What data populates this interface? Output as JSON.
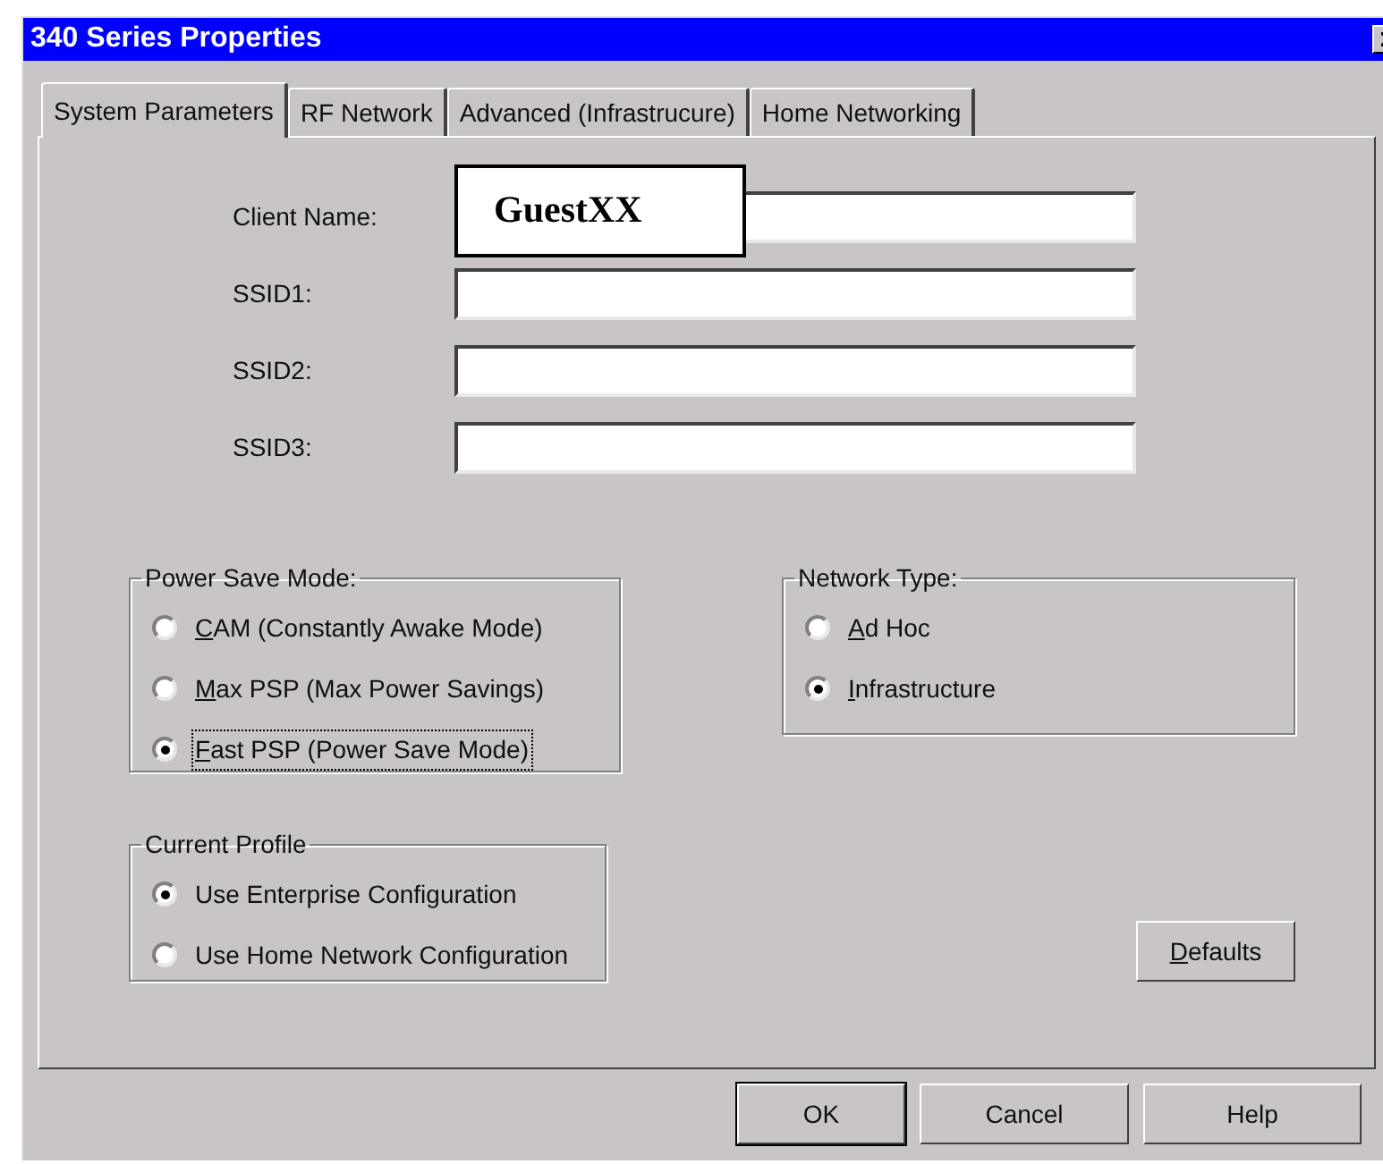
{
  "window": {
    "title": "340 Series Properties"
  },
  "tabs": [
    {
      "label": "System Parameters",
      "selected": true
    },
    {
      "label": "RF Network",
      "selected": false
    },
    {
      "label": "Advanced (Infrastrucure)",
      "selected": false
    },
    {
      "label": "Home Networking",
      "selected": false
    }
  ],
  "fields": [
    {
      "label": "Client Name:"
    },
    {
      "label": "SSID1:"
    },
    {
      "label": "SSID2:"
    },
    {
      "label": "SSID3:"
    }
  ],
  "annotation": {
    "text": "GuestXX"
  },
  "power_save_mode": {
    "title": "Power Save Mode:",
    "options": [
      {
        "label": "CAM (Constantly Awake Mode)",
        "selected": false,
        "mnemonic": true,
        "focused": false
      },
      {
        "label": "Max PSP (Max Power Savings)",
        "selected": false,
        "mnemonic": true,
        "focused": false
      },
      {
        "label": "Fast PSP (Power Save Mode)",
        "selected": true,
        "mnemonic": true,
        "focused": true
      }
    ]
  },
  "current_profile": {
    "title": "Current Profile",
    "options": [
      {
        "label": "Use Enterprise Configuration",
        "selected": true,
        "mnemonic": false,
        "focused": false
      },
      {
        "label": "Use Home Network Configuration",
        "selected": false,
        "mnemonic": false,
        "focused": false
      }
    ]
  },
  "network_type": {
    "title": "Network Type:",
    "options": [
      {
        "label": "Ad Hoc",
        "selected": false,
        "mnemonic": true,
        "focused": false
      },
      {
        "label": "Infrastructure",
        "selected": true,
        "mnemonic": true,
        "focused": false
      }
    ]
  },
  "defaults_button": {
    "label": "Defaults",
    "mnemonic": true
  },
  "buttons": [
    {
      "label": "OK",
      "default": true
    },
    {
      "label": "Cancel",
      "default": false
    },
    {
      "label": "Help",
      "default": false
    }
  ]
}
